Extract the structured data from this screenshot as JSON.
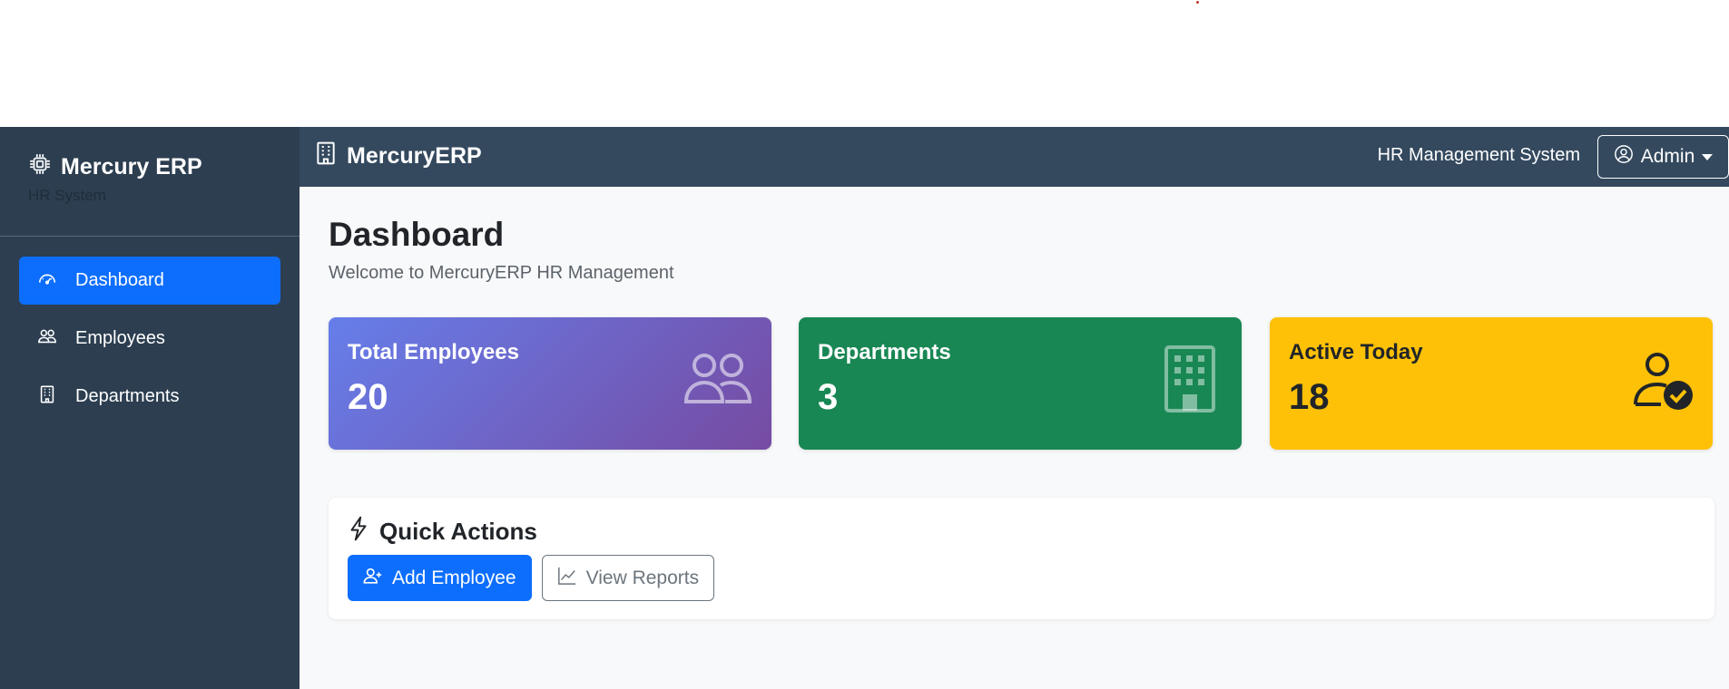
{
  "sidebar": {
    "brand": "Mercury ERP",
    "subtitle": "HR System",
    "items": [
      {
        "label": "Dashboard",
        "icon": "speedometer-icon",
        "active": true
      },
      {
        "label": "Employees",
        "icon": "people-icon",
        "active": false
      },
      {
        "label": "Departments",
        "icon": "building-icon",
        "active": false
      }
    ]
  },
  "topbar": {
    "brand": "MercuryERP",
    "system_name": "HR Management System",
    "user_label": "Admin"
  },
  "main": {
    "title": "Dashboard",
    "subtitle": "Welcome to MercuryERP HR Management",
    "cards": [
      {
        "label": "Total Employees",
        "value": "20",
        "icon": "people-icon",
        "color": "#667eea"
      },
      {
        "label": "Departments",
        "value": "3",
        "icon": "building-icon",
        "color": "#198754"
      },
      {
        "label": "Active Today",
        "value": "18",
        "icon": "person-check-icon",
        "color": "#ffc107"
      }
    ],
    "quick_actions": {
      "title": "Quick Actions",
      "add_employee": "Add Employee",
      "view_reports": "View Reports"
    }
  },
  "colors": {
    "sidebar_bg": "#2c3e50",
    "topbar_bg": "#34495e",
    "accent": "#0d6efd"
  }
}
